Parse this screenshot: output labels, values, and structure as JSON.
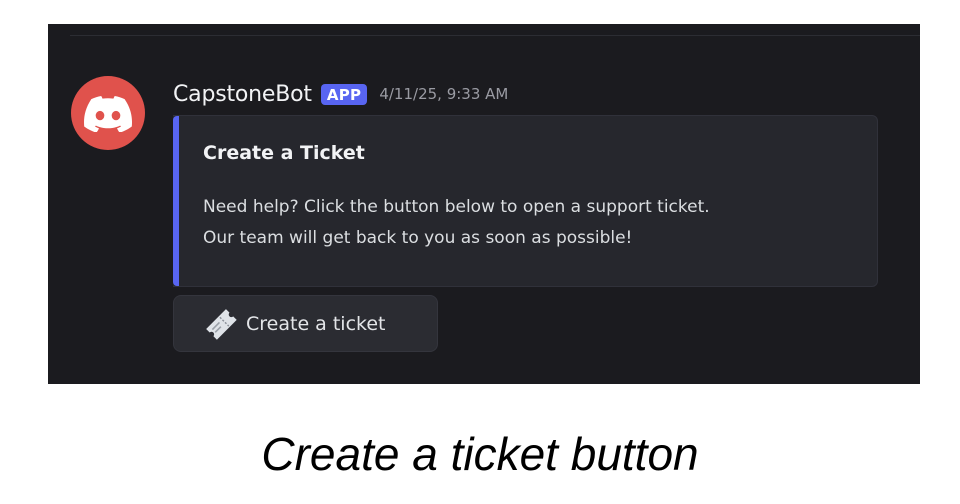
{
  "message": {
    "username": "CapstoneBot",
    "badge": "APP",
    "timestamp": "4/11/25, 9:33 AM",
    "avatar_icon": "discord-logo-icon",
    "avatar_color": "#e0524c"
  },
  "embed": {
    "accent_color": "#5865f2",
    "title": "Create a Ticket",
    "description_lines": [
      "Need help? Click the button below to open a support ticket.",
      "Our team will get back to you as soon as possible!"
    ]
  },
  "button": {
    "icon": "ticket-icon",
    "label": "Create a ticket"
  },
  "caption": "Create a ticket button"
}
